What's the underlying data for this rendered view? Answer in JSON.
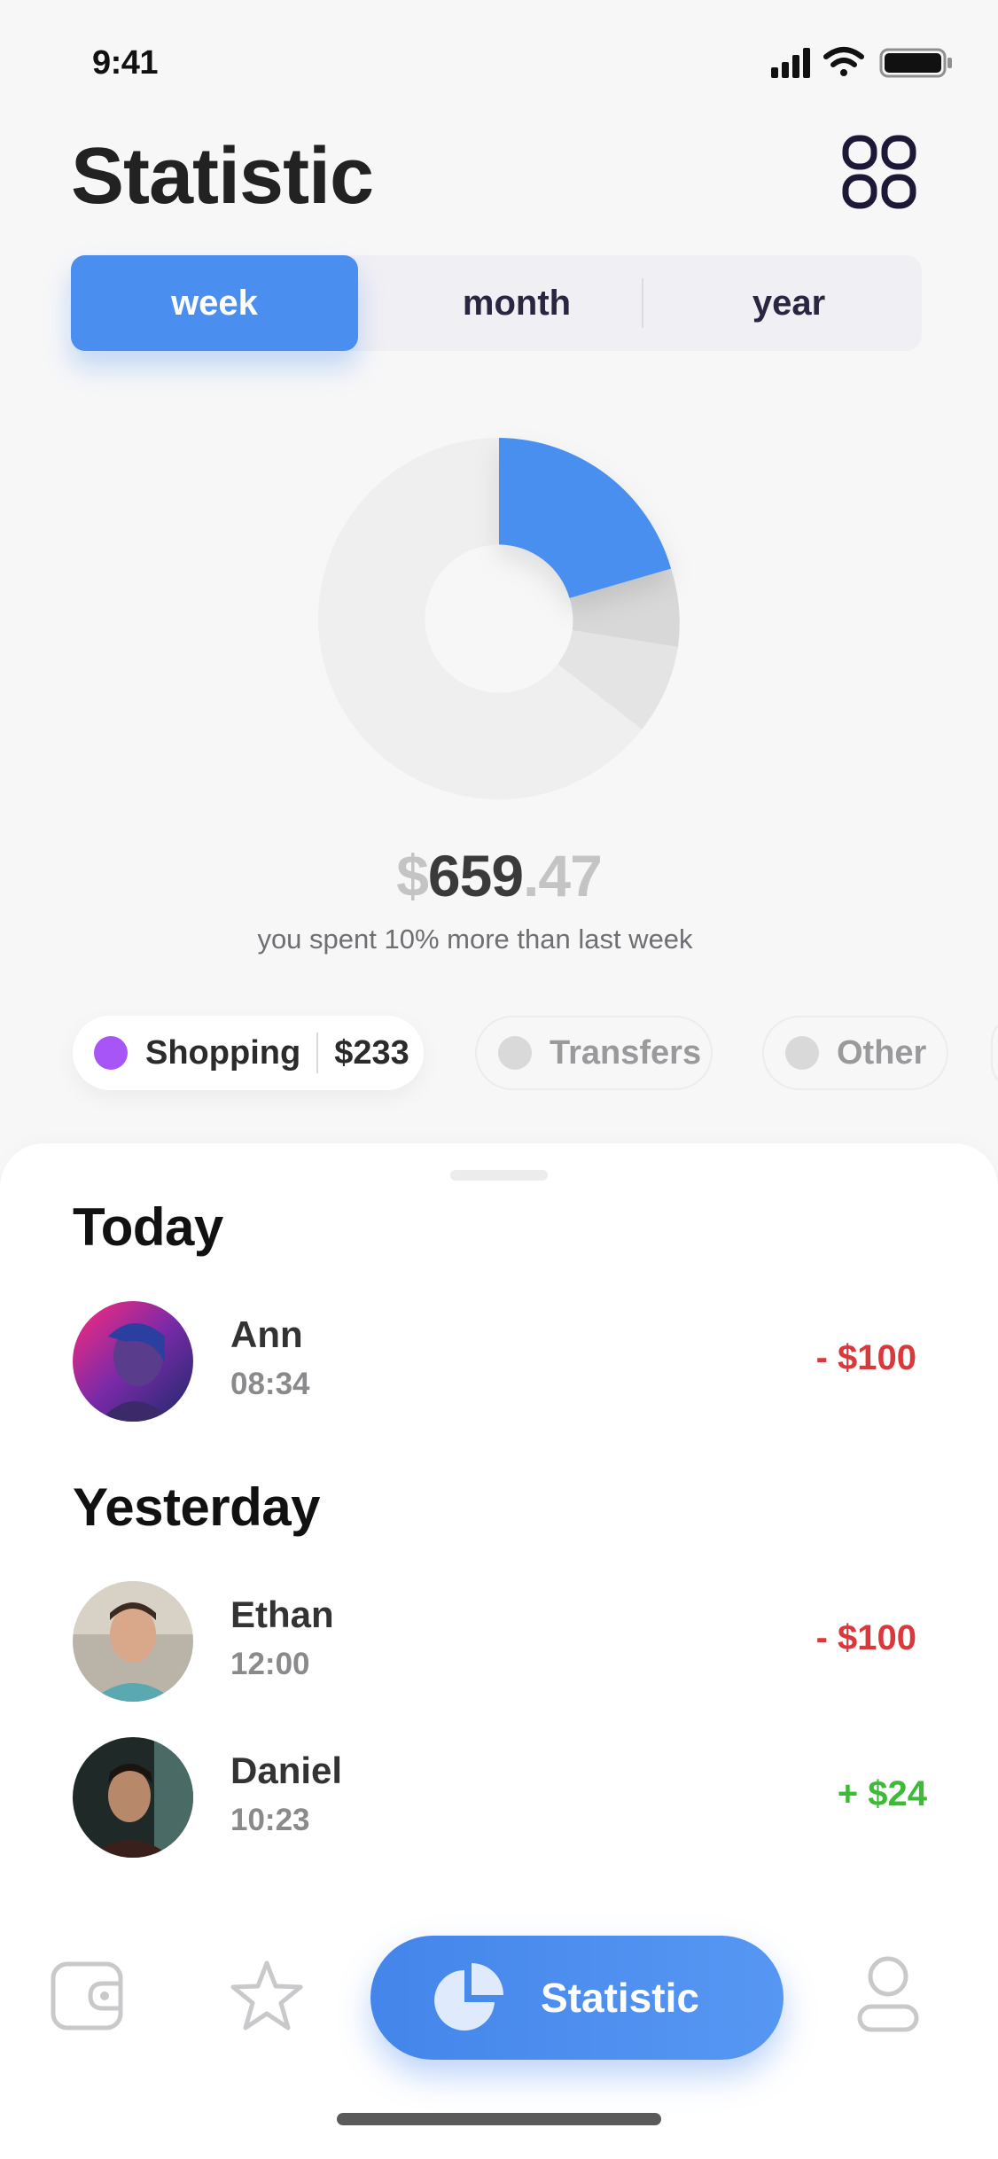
{
  "status_bar": {
    "time": "9:41"
  },
  "header": {
    "title": "Statistic"
  },
  "tabs": [
    {
      "label": "week",
      "active": true
    },
    {
      "label": "month",
      "active": false
    },
    {
      "label": "year",
      "active": false
    }
  ],
  "summary": {
    "currency": "$",
    "amount_main": "659",
    "amount_decimal": ".47",
    "note": "you spent 10% more than last week"
  },
  "categories": [
    {
      "label": "Shopping",
      "value": "$233",
      "color": "#a855f7",
      "active": true
    },
    {
      "label": "Transfers",
      "color": "#d9d9d9",
      "active": false
    },
    {
      "label": "Other",
      "color": "#d9d9d9",
      "active": false
    }
  ],
  "transactions": {
    "today_title": "Today",
    "yesterday_title": "Yesterday",
    "today": [
      {
        "name": "Ann",
        "time": "08:34",
        "amount": "- $100",
        "type": "negative"
      }
    ],
    "yesterday": [
      {
        "name": "Ethan",
        "time": "12:00",
        "amount": "- $100",
        "type": "negative"
      },
      {
        "name": "Daniel",
        "time": "10:23",
        "amount": "+ $24",
        "type": "positive"
      }
    ]
  },
  "nav": {
    "items": [
      "wallet-icon",
      "star-icon",
      "pie-chart-icon",
      "profile-icon"
    ],
    "active_label": "Statistic"
  },
  "colors": {
    "accent": "#4a8ff0",
    "negative": "#d9393b",
    "positive": "#3dbb38",
    "shopping": "#a855f7"
  }
}
